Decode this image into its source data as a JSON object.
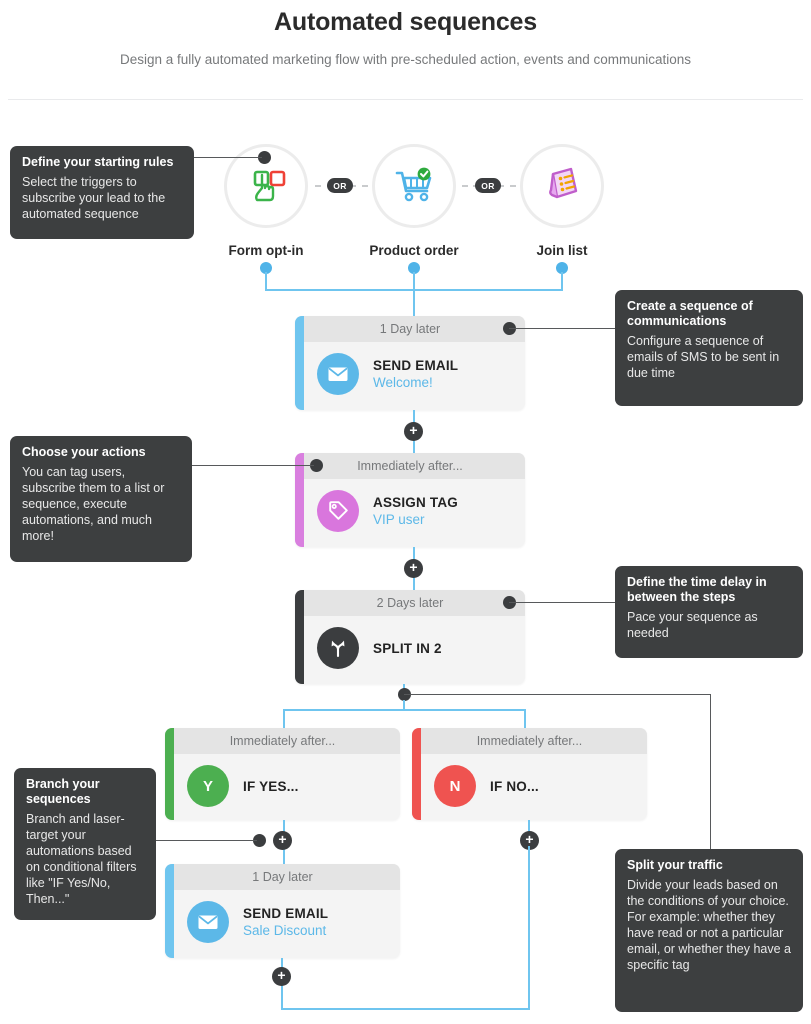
{
  "header": {
    "title": "Automated sequences",
    "subtitle": "Design a fully automated marketing flow with pre-scheduled action, events and communications"
  },
  "triggers": {
    "or_label_1": "OR",
    "or_label_2": "OR",
    "items": [
      {
        "label": "Form opt-in",
        "icon": "hand-click-form-icon"
      },
      {
        "label": "Product order",
        "icon": "shopping-cart-check-icon"
      },
      {
        "label": "Join list",
        "icon": "list-document-icon"
      }
    ]
  },
  "steps": [
    {
      "timing": "1 Day later",
      "action": "SEND EMAIL",
      "detail": "Welcome!",
      "icon": "envelope-icon",
      "accent": "#6fc5ef"
    },
    {
      "timing": "Immediately after...",
      "action": "ASSIGN TAG",
      "detail": "VIP user",
      "icon": "tag-icon",
      "accent": "#d97fdf"
    },
    {
      "timing": "2 Days later",
      "action": "SPLIT IN 2",
      "detail": "",
      "icon": "split-fork-icon",
      "accent": "#3b3d3f"
    }
  ],
  "branches": [
    {
      "timing": "Immediately after...",
      "action": "IF YES...",
      "badge": "Y",
      "icon": "yes-badge-icon",
      "accent": "#4caf50"
    },
    {
      "timing": "Immediately after...",
      "action": "IF NO...",
      "badge": "N",
      "icon": "no-badge-icon",
      "accent": "#ef5350"
    }
  ],
  "branch_step": {
    "timing": "1 Day later",
    "action": "SEND EMAIL",
    "detail": "Sale Discount",
    "icon": "envelope-icon",
    "accent": "#6fc5ef"
  },
  "plus_buttons": {
    "label": "+"
  },
  "callouts": [
    {
      "title": "Define your starting rules",
      "body": "Select the triggers to subscribe your lead to the automated sequence"
    },
    {
      "title": "Create a sequence of communications",
      "body": "Configure a sequence of emails of SMS to be sent in due time"
    },
    {
      "title": "Choose your actions",
      "body": "You can tag users, subscribe them to a list or sequence, execute automations, and much more!"
    },
    {
      "title": "Define the time delay in between the steps",
      "body": "Pace your sequence as needed"
    },
    {
      "title": "Branch your sequences",
      "body": "Branch and laser-target your automations based on conditional filters like \"IF Yes/No, Then...\""
    },
    {
      "title": "Split your traffic",
      "body": "Divide your leads based on the conditions of your choice. For example: whether they have read or not a particular email, or whether they have a specific tag"
    }
  ],
  "colors": {
    "blue": "#6fc5ef",
    "purple": "#d97fdf",
    "green": "#4caf50",
    "red": "#ef5350",
    "dark": "#3b3d3f",
    "card_bg": "#f4f4f4",
    "card_header": "#e4e4e4"
  }
}
